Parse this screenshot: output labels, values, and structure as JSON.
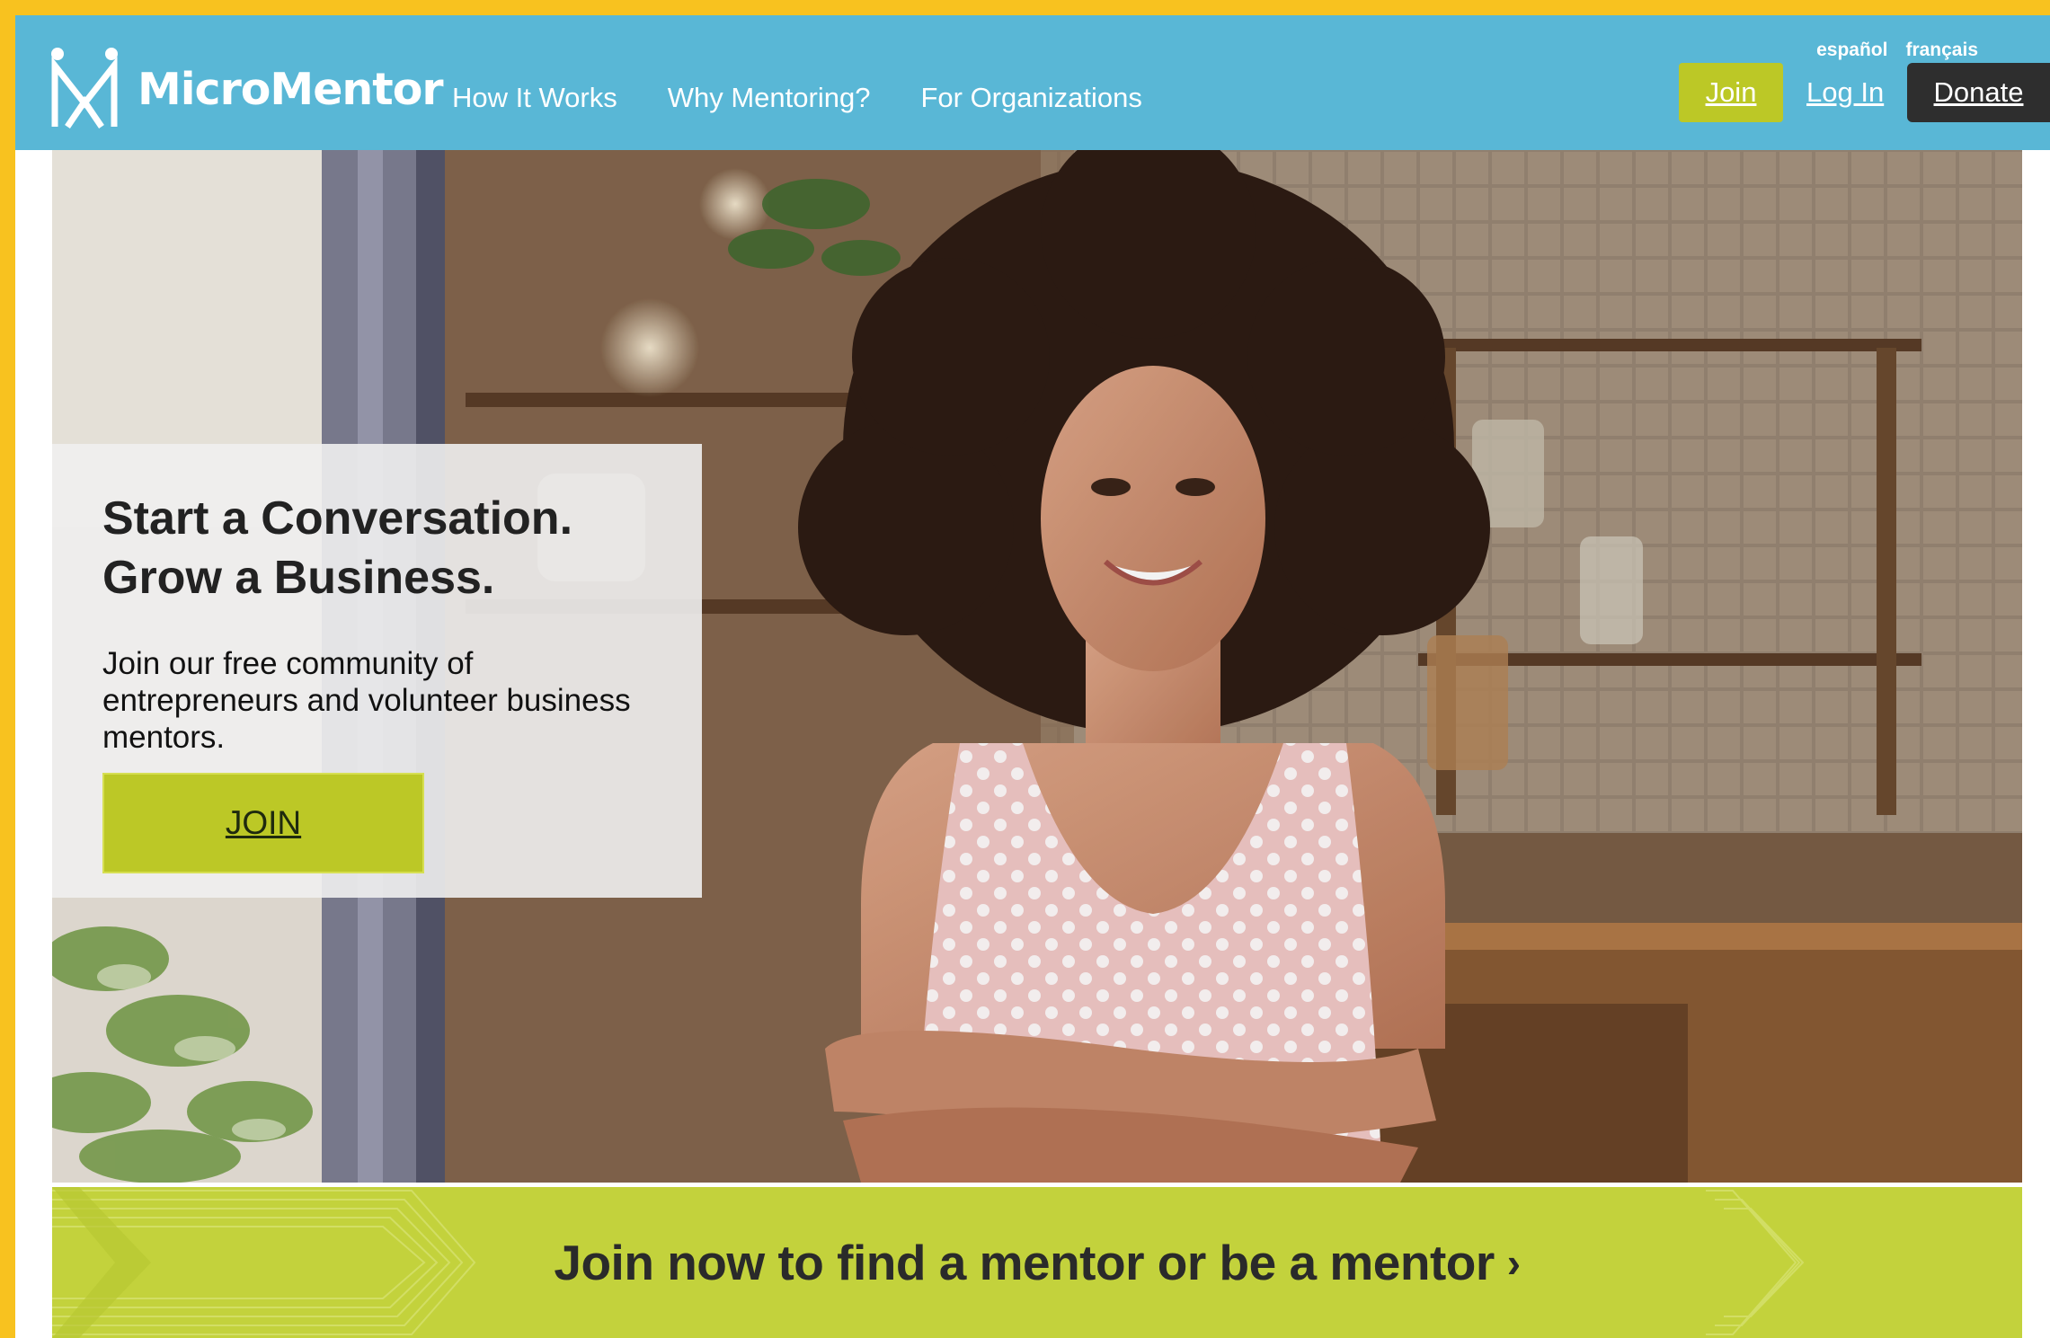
{
  "brand": {
    "name": "MicroMentor",
    "primary_color": "#59B7D6",
    "accent_color": "#BCC826",
    "dark_color": "#2E2E2E",
    "frame_color": "#F8C21F"
  },
  "header": {
    "logo_icon": "micromentor-logo-icon",
    "nav": [
      {
        "label": "How It Works"
      },
      {
        "label": "Why Mentoring?"
      },
      {
        "label": "For Organizations"
      }
    ],
    "languages": [
      "español",
      "français"
    ],
    "join_label": "Join",
    "login_label": "Log In",
    "donate_label": "Donate"
  },
  "hero": {
    "title_line1": "Start a Conversation.",
    "title_line2": "Grow a Business.",
    "subtitle": "Join our free community of entrepreneurs and volunteer business mentors.",
    "join_label": "JOIN"
  },
  "cta": {
    "text": "Join now to find a mentor or be a mentor",
    "chevron": "›"
  }
}
